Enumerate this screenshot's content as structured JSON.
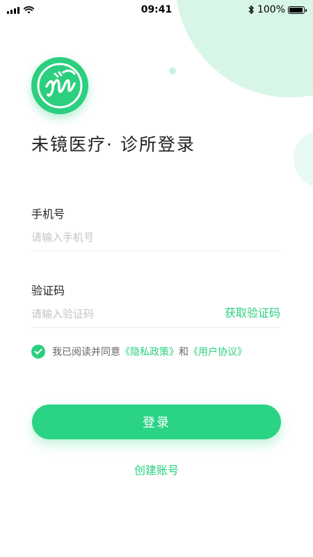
{
  "status_bar": {
    "time": "09:41",
    "battery_text": "100%",
    "battery_level": 1.0
  },
  "app": {
    "title": "未镜医疗· 诊所登录",
    "brand_color": "#2bcf7f"
  },
  "phone_field": {
    "label": "手机号",
    "placeholder": "请输入手机号",
    "value": ""
  },
  "code_field": {
    "label": "验证码",
    "placeholder": "请输入验证码",
    "value": "",
    "get_code_label": "获取验证码"
  },
  "agreement": {
    "checked": true,
    "prefix": "我已阅读并同意",
    "privacy_link": "《隐私政策》",
    "conjunction": "和",
    "user_agreement_link": "《用户协议》"
  },
  "login_button": {
    "label": "登录"
  },
  "create_account": {
    "label": "创建账号"
  }
}
